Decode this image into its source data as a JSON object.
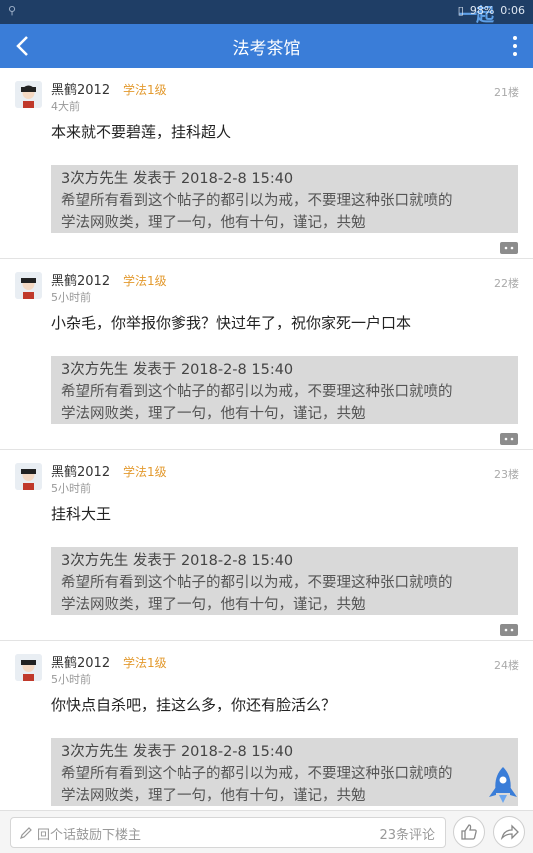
{
  "status_bar": {
    "battery": "98%",
    "time": "0:06",
    "watermark": "一起"
  },
  "nav": {
    "title": "法考茶馆"
  },
  "posts": [
    {
      "username": "黑鹤2012",
      "level": "学法1级",
      "time": "4大前",
      "floor": "21楼",
      "content": "本来就不要碧莲，挂科超人",
      "quote_head": "3次方先生 发表于 2018-2-8 15:40",
      "quote_line1": "希望所有看到这个帖子的都引以为戒，不要理这种张口就喷的",
      "quote_line2": "学法网败类，理了一句，他有十句，谨记，共勉"
    },
    {
      "username": "黑鹤2012",
      "level": "学法1级",
      "time": "5小时前",
      "floor": "22楼",
      "content": "小杂毛，你举报你爹我？快过年了，祝你家死一户口本",
      "quote_head": "3次方先生 发表于 2018-2-8 15:40",
      "quote_line1": "希望所有看到这个帖子的都引以为戒，不要理这种张口就喷的",
      "quote_line2": "学法网败类，理了一句，他有十句，谨记，共勉"
    },
    {
      "username": "黑鹤2012",
      "level": "学法1级",
      "time": "5小时前",
      "floor": "23楼",
      "content": "挂科大王",
      "quote_head": "3次方先生 发表于 2018-2-8 15:40",
      "quote_line1": "希望所有看到这个帖子的都引以为戒，不要理这种张口就喷的",
      "quote_line2": "学法网败类，理了一句，他有十句，谨记，共勉"
    },
    {
      "username": "黑鹤2012",
      "level": "学法1级",
      "time": "5小时前",
      "floor": "24楼",
      "content": "你快点自杀吧，挂这么多，你还有脸活么？",
      "quote_head": "3次方先生 发表于 2018-2-8 15:40",
      "quote_line1": "希望所有看到这个帖子的都引以为戒，不要理这种张口就喷的",
      "quote_line2": "学法网败类，理了一句，他有十句，谨记，共勉"
    }
  ],
  "bottom": {
    "placeholder": "回个话鼓励下楼主",
    "comment_count": "23条评论"
  },
  "colors": {
    "nav_bg": "#3a7dd8",
    "level": "#e39a2f",
    "quote_bg": "#d9d9d9"
  }
}
